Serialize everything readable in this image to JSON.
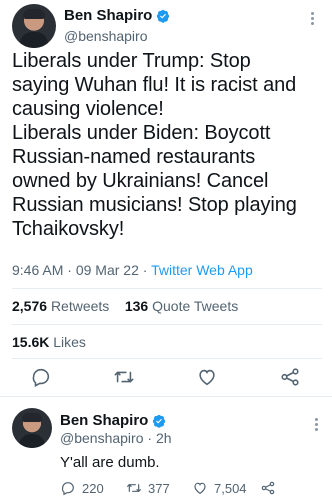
{
  "tweet": {
    "author_name": "Ben Shapiro",
    "author_handle": "@benshapiro",
    "text": "Liberals under Trump: Stop\nsaying Wuhan flu! It is racist and\ncausing violence!\nLiberals under Biden: Boycott\nRussian-named restaurants\nowned by Ukrainians! Cancel\nRussian musicians! Stop playing\nTchaikovsky!",
    "time": "9:46 AM",
    "date": "09 Mar 22",
    "separator": "·",
    "source": "Twitter Web App",
    "retweets_count": "2,576",
    "retweets_label": "Retweets",
    "quote_count": "136",
    "quote_label": "Quote Tweets",
    "likes_count": "15.6K",
    "likes_label": "Likes"
  },
  "reply": {
    "author_name": "Ben Shapiro",
    "author_handle": "@benshapiro",
    "separator": "·",
    "age": "2h",
    "text": "Y'all are dumb.",
    "reply_count": "220",
    "retweet_count": "377",
    "like_count": "7,504"
  },
  "icons": {
    "verified": "verified-badge-icon",
    "reply": "reply-icon",
    "retweet": "retweet-icon",
    "like": "heart-icon",
    "share": "share-icon",
    "more": "more-icon"
  },
  "colors": {
    "link_blue": "#1d9bf0",
    "secondary_text": "#536471",
    "primary_text": "#0f1419"
  }
}
